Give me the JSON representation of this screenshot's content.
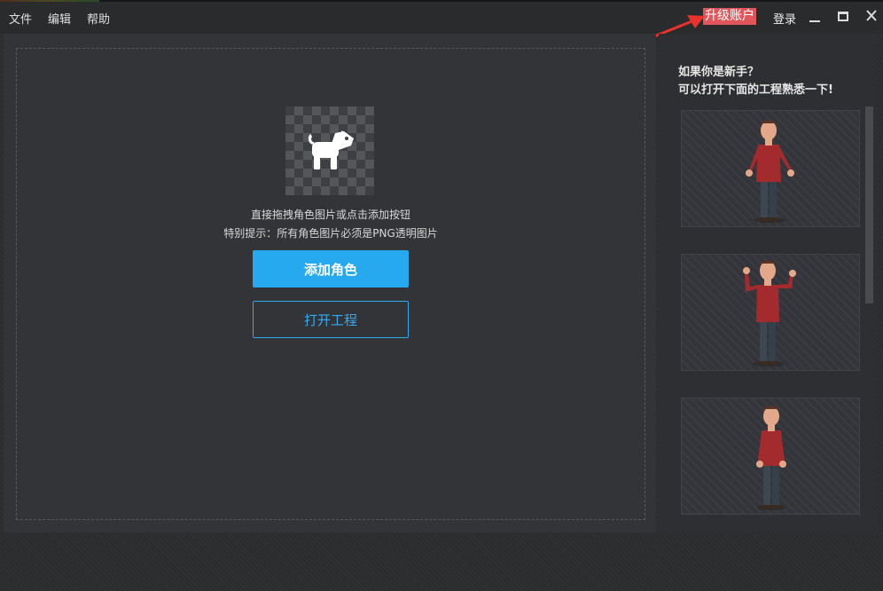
{
  "menu": {
    "file": "文件",
    "edit": "编辑",
    "help": "帮助"
  },
  "header": {
    "upgrade_label": "升级账户",
    "login_label": "登录"
  },
  "window_controls": [
    "minimize-icon",
    "maximize-icon",
    "close-icon"
  ],
  "main": {
    "hint_line1": "直接拖拽角色图片或点击添加按钮",
    "hint_line2": "特别提示：所有角色图片必须是PNG透明图片",
    "add_role_label": "添加角色",
    "open_project_label": "打开工程"
  },
  "sidebar": {
    "title_line1": "如果你是新手？",
    "title_line2": "可以打开下面的工程熟悉一下!",
    "samples": [
      "character-arms-down",
      "character-arms-raised",
      "character-hands-at-sides"
    ]
  },
  "colors": {
    "accent_blue": "#27a9f0",
    "upgrade_red": "#e2565b",
    "panel_bg": "#333437",
    "sidebar_bg": "#2e2f32"
  }
}
